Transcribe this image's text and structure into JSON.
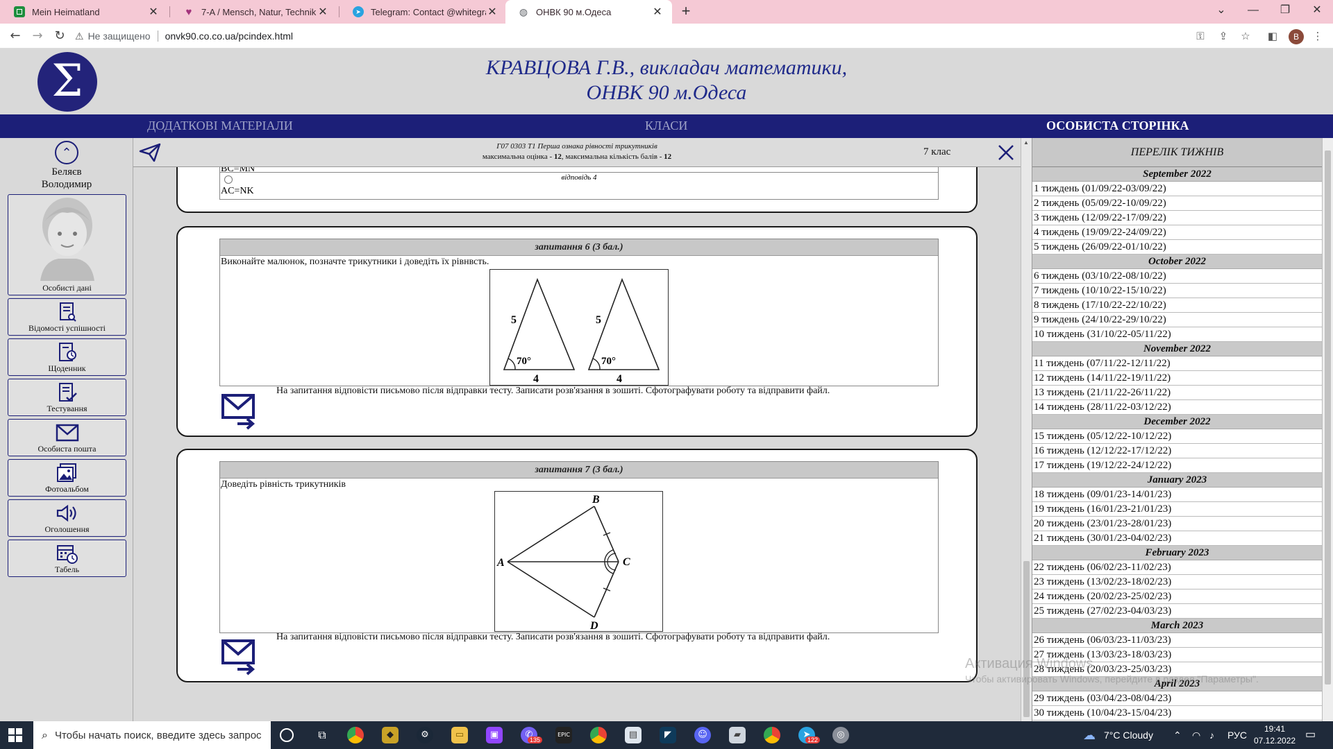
{
  "browser": {
    "tabs": [
      {
        "title": "Mein Heimatland",
        "favicon_color": "#1e8e3e"
      },
      {
        "title": "7-A / Mensch, Natur, Technik",
        "favicon_color": "#a3337c"
      },
      {
        "title": "Telegram: Contact @whitegrapes",
        "favicon_color": "#2aa3e0"
      },
      {
        "title": "ОНВК 90 м.Одеса",
        "favicon_color": "#5f6368"
      }
    ],
    "security_label": "Не защищено",
    "url": "onvk90.co.co.ua/pcindex.html",
    "profile_initial": "B"
  },
  "site": {
    "title_line1": "КРАВЦОВА Г.В., викладач математики,",
    "title_line2": "ОНВК 90 м.Одеса",
    "logo_symbol": "Σ",
    "nav": {
      "extra": "ДОДАТКОВІ МАТЕРІАЛИ",
      "classes": "КЛАСИ",
      "personal": "ОСОБИСТА СТОРІНКА"
    }
  },
  "sidebar": {
    "user_name_line1": "Беляєв",
    "user_name_line2": "Володимир",
    "items": [
      {
        "label": "Особисті дані"
      },
      {
        "label": "Відомості успішності"
      },
      {
        "label": "Щоденник"
      },
      {
        "label": "Тестування"
      },
      {
        "label": "Особиста пошта"
      },
      {
        "label": "Фотоальбом"
      },
      {
        "label": "Оголошення"
      },
      {
        "label": "Табель"
      }
    ]
  },
  "quiz": {
    "title": "Г07 0303 Т1 Перша ознака рівності трикутників",
    "score_prefix": "максимальна оцінка - ",
    "max_grade": "12",
    "score_mid": ", максимальна кількість балів - ",
    "max_points": "12",
    "class_label": "7 клас",
    "prev_option_partial": "BC=MN",
    "prev_option_label": "відповідь 4",
    "prev_option_text": "AC=NK",
    "questions": [
      {
        "header": "запитання 6 (3 бал.)",
        "text": "Виконайте малюнок, позначте трикутники і доведіть їх рівнвсть.",
        "figure": {
          "side_label": "5",
          "angle_label": "70°",
          "base_label": "4"
        },
        "answer_note": "На запитання відповісти письмово після відправки тесту. Записати розв'язання в зошиті. Сфотографувати роботу та відправити файл."
      },
      {
        "header": "запитання 7 (3 бал.)",
        "text": "Доведіть рівність трикутників",
        "figure": {
          "A": "A",
          "B": "B",
          "C": "C",
          "D": "D"
        },
        "answer_note": "На запитання відповісти письмово після відправки тесту. Записати розв'язання в зошиті. Сфотографувати роботу та відправити файл."
      }
    ]
  },
  "weeks": {
    "title": "ПЕРЕЛІК ТИЖНІВ",
    "groups": [
      {
        "month": "September 2022",
        "weeks": [
          "1 тиждень (01/09/22-03/09/22)",
          "2 тиждень (05/09/22-10/09/22)",
          "3 тиждень (12/09/22-17/09/22)",
          "4 тиждень (19/09/22-24/09/22)",
          "5 тиждень (26/09/22-01/10/22)"
        ]
      },
      {
        "month": "October 2022",
        "weeks": [
          "6 тиждень (03/10/22-08/10/22)",
          "7 тиждень (10/10/22-15/10/22)",
          "8 тиждень (17/10/22-22/10/22)",
          "9 тиждень (24/10/22-29/10/22)",
          "10 тиждень (31/10/22-05/11/22)"
        ]
      },
      {
        "month": "November 2022",
        "weeks": [
          "11 тиждень (07/11/22-12/11/22)",
          "12 тиждень (14/11/22-19/11/22)",
          "13 тиждень (21/11/22-26/11/22)",
          "14 тиждень (28/11/22-03/12/22)"
        ]
      },
      {
        "month": "December 2022",
        "weeks": [
          "15 тиждень (05/12/22-10/12/22)",
          "16 тиждень (12/12/22-17/12/22)",
          "17 тиждень (19/12/22-24/12/22)"
        ]
      },
      {
        "month": "January 2023",
        "weeks": [
          "18 тиждень (09/01/23-14/01/23)",
          "19 тиждень (16/01/23-21/01/23)",
          "20 тиждень (23/01/23-28/01/23)",
          "21 тиждень (30/01/23-04/02/23)"
        ]
      },
      {
        "month": "February 2023",
        "weeks": [
          "22 тиждень (06/02/23-11/02/23)",
          "23 тиждень (13/02/23-18/02/23)",
          "24 тиждень (20/02/23-25/02/23)",
          "25 тиждень (27/02/23-04/03/23)"
        ]
      },
      {
        "month": "March 2023",
        "weeks": [
          "26 тиждень (06/03/23-11/03/23)",
          "27 тиждень (13/03/23-18/03/23)",
          "28 тиждень (20/03/23-25/03/23)"
        ]
      },
      {
        "month": "April 2023",
        "weeks": [
          "29 тиждень (03/04/23-08/04/23)",
          "30 тиждень (10/04/23-15/04/23)"
        ]
      }
    ]
  },
  "watermark": {
    "line1": "Активация Windows",
    "line2": "Чтобы активировать Windows, перейдите в раздел \"Параметры\"."
  },
  "taskbar": {
    "search_placeholder": "Чтобы начать поиск, введите здесь запрос",
    "weather": "7°C  Cloudy",
    "language": "РУС",
    "time": "19:41",
    "date": "07.12.2022",
    "badges": {
      "viber": "135",
      "telegram": "122"
    }
  },
  "colors": {
    "brand_navy": "#1c1f78",
    "title_blue": "#1f2a8a",
    "tabbar_pink": "#f5c9d5"
  }
}
